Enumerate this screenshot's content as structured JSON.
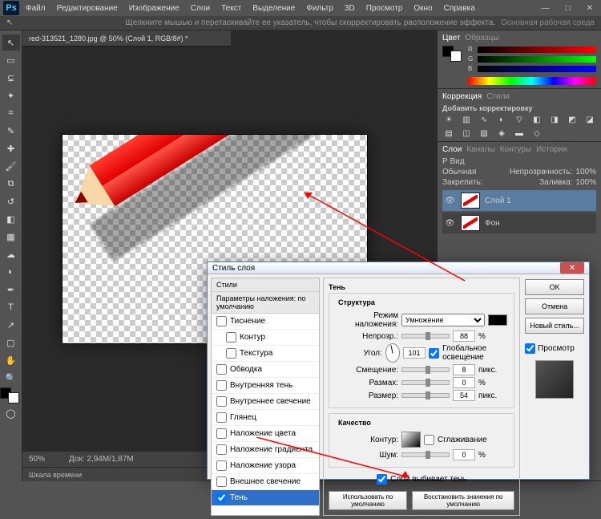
{
  "app": {
    "logo_text": "Ps"
  },
  "menu": {
    "file": "Файл",
    "edit": "Редактирование",
    "image": "Изображение",
    "layer": "Слои",
    "text": "Текст",
    "select": "Выделение",
    "filter": "Фильтр",
    "threed": "3D",
    "view": "Просмотр",
    "window": "Окно",
    "help": "Справка"
  },
  "options": {
    "hint": "Щелкните мышью и перетаскивайте ее указатель, чтобы скорректировать расположение эффекта.",
    "workspace": "Основная рабочая среда"
  },
  "document": {
    "tab": "red-313521_1280.jpg @ 50% (Слой 1, RGB/8#) *",
    "zoom": "50%",
    "docinfo": "Док: 2,94M/1,87M"
  },
  "timeline": {
    "label": "Шкала времени"
  },
  "panel_color": {
    "tab1": "Цвет",
    "tab2": "Образцы",
    "r": "R",
    "g": "G",
    "b": "B"
  },
  "panel_adjust": {
    "tab1": "Коррекция",
    "tab2": "Стили",
    "title": "Добавить корректировку"
  },
  "panel_layers": {
    "tab1": "Слои",
    "tab2": "Каналы",
    "tab3": "Контуры",
    "tab4": "История",
    "mode_lbl": "Обычная",
    "opacity_lbl": "Непрозрачность:",
    "opacity_val": "100%",
    "lock_lbl": "Закрепить:",
    "fill_lbl": "Заливка:",
    "fill_val": "100%",
    "layer1": "Слой 1",
    "layer_bg": "Фон",
    "kind": "Р Вид"
  },
  "dialog": {
    "title": "Стиль слоя",
    "styles_header": "Стили",
    "blend_opts": "Параметры наложения: по умолчанию",
    "items": {
      "bevel": "Тиснение",
      "stroke_c": "Контур",
      "texture": "Текстура",
      "stroke": "Обводка",
      "inner_shadow": "Внутренняя тень",
      "inner_glow": "Внутреннее свечение",
      "satin": "Глянец",
      "color_ov": "Наложение цвета",
      "grad_ov": "Наложение градиента",
      "pat_ov": "Наложение узора",
      "outer_glow": "Внешнее свечение",
      "drop_shadow": "Тень"
    },
    "section": "Тень",
    "grp_structure": "Структура",
    "blend_mode": "Режим наложения:",
    "blend_mode_val": "Умножение",
    "opacity": "Непрозр.:",
    "opacity_val": "88",
    "pct": "%",
    "angle": "Угол:",
    "angle_val": "101",
    "global": "Глобальное освещение",
    "distance": "Смещение:",
    "distance_val": "8",
    "px": "пикс.",
    "spread": "Размах:",
    "spread_val": "0",
    "size": "Размер:",
    "size_val": "54",
    "grp_quality": "Качество",
    "contour": "Контур:",
    "antialias": "Сглаживание",
    "noise": "Шум:",
    "noise_val": "0",
    "knockout": "Слой выбивает тень",
    "make_default": "Использовать по умолчанию",
    "reset_default": "Восстановить значения по умолчанию",
    "ok": "OK",
    "cancel": "Отмена",
    "new_style": "Новый стиль...",
    "preview": "Просмотр"
  }
}
